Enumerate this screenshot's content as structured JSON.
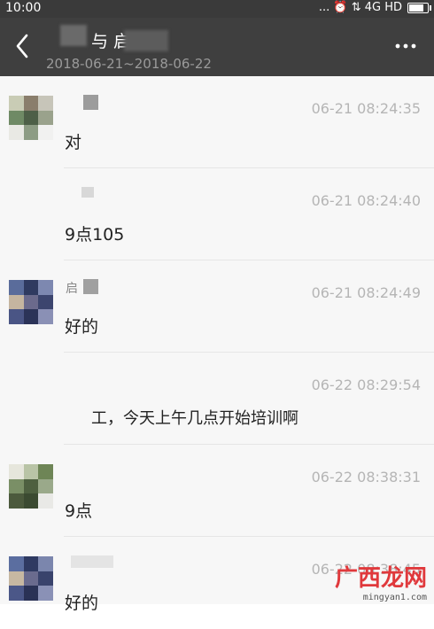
{
  "status": {
    "time": "10:00",
    "icons": "... ⏰ ⇅ 4G HD",
    "battery_icon": "battery-icon"
  },
  "header": {
    "title": "与 启",
    "date_range": "2018-06-21~2018-06-22",
    "back_icon": "back-arrow-icon",
    "more_icon": "more-dots-icon",
    "bg": "#3f3f3f"
  },
  "messages": [
    {
      "sender": "",
      "time": "06-21 08:24:35",
      "text": "对"
    },
    {
      "sender": "",
      "time": "06-21 08:24:40",
      "text": "9点105"
    },
    {
      "sender": "启",
      "time": "06-21 08:24:49",
      "text": "好的"
    },
    {
      "sender": "",
      "time": "06-22 08:29:54",
      "text": "工，今天上午几点开始培训啊"
    },
    {
      "sender": "",
      "time": "06-22 08:38:31",
      "text": "9点"
    },
    {
      "sender": "",
      "time": "06-22 08:38:45",
      "text": "好的"
    }
  ],
  "watermark": {
    "logo": "广西龙网",
    "url": "mingyan1.com"
  }
}
